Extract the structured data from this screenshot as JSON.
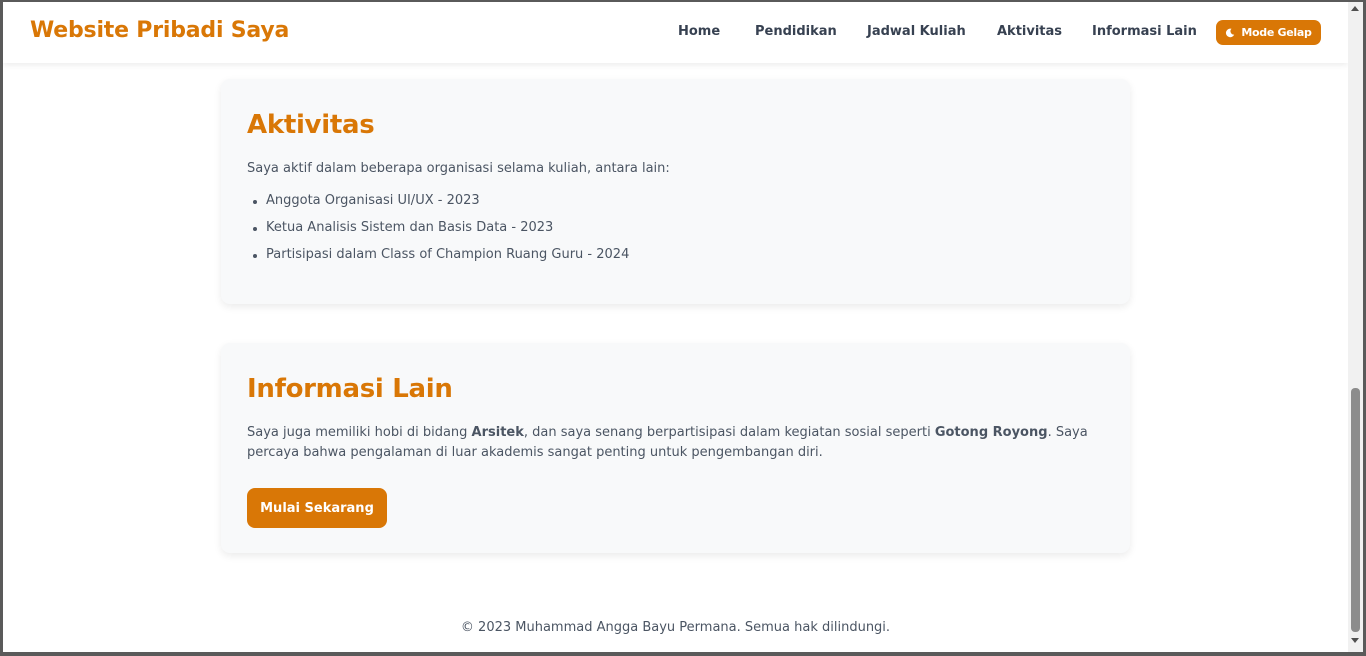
{
  "header": {
    "brand": "Website Pribadi Saya",
    "nav": [
      "Home",
      "Pendidikan",
      "Jadwal Kuliah",
      "Aktivitas",
      "Informasi Lain"
    ],
    "mode_button": "Mode Gelap",
    "mode_icon": "moon-icon"
  },
  "aktivitas": {
    "title": "Aktivitas",
    "intro": "Saya aktif dalam beberapa organisasi selama kuliah, antara lain:",
    "items": [
      "Anggota Organisasi UI/UX - 2023",
      "Ketua Analisis Sistem dan Basis Data - 2023",
      "Partisipasi dalam Class of Champion Ruang Guru - 2024"
    ]
  },
  "informasi": {
    "title": "Informasi Lain",
    "text_1": "Saya juga memiliki hobi di bidang ",
    "bold_1": "Arsitek",
    "text_2": ", dan saya senang berpartisipasi dalam kegiatan sosial seperti ",
    "bold_2": "Gotong Royong",
    "text_3": ". Saya percaya bahwa pengalaman di luar akademis sangat penting untuk pengembangan diri.",
    "cta": "Mulai Sekarang"
  },
  "footer": {
    "text": "© 2023 Muhammad Angga Bayu Permana. Semua hak dilindungi."
  },
  "colors": {
    "accent": "#d97706",
    "card_bg": "#f8f9fa",
    "text": "#4b5563"
  }
}
